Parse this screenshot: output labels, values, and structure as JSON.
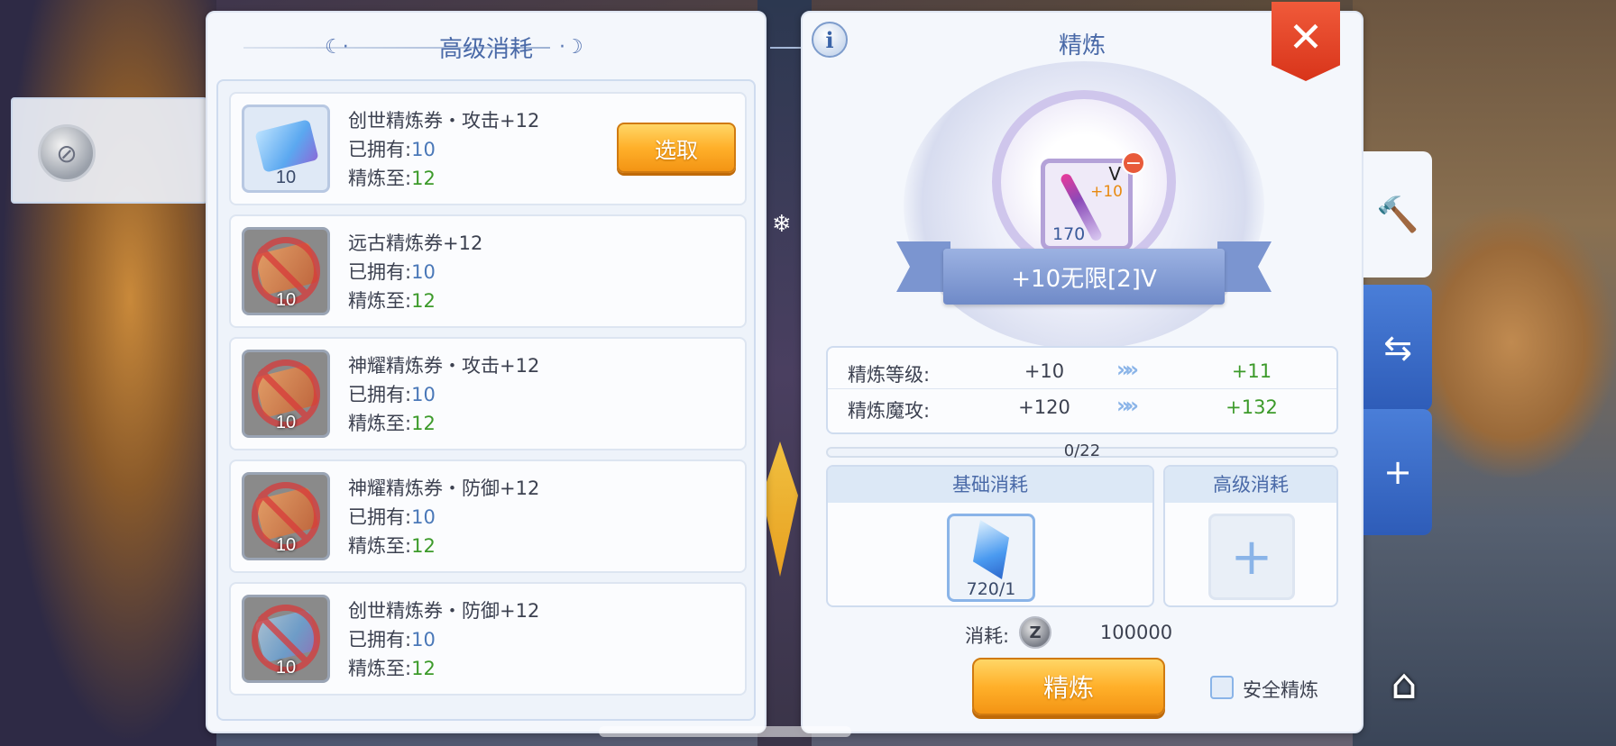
{
  "advanced_panel": {
    "title": "高级消耗",
    "items": [
      {
        "name": "创世精炼券・攻击+12",
        "count": "10",
        "owned_label": "已拥有:",
        "owned": "10",
        "refine_label": "精炼至:",
        "refine_to": "12",
        "locked": false,
        "action": "选取"
      },
      {
        "name": "远古精炼券+12",
        "count": "10",
        "owned_label": "已拥有:",
        "owned": "10",
        "refine_label": "精炼至:",
        "refine_to": "12",
        "locked": true
      },
      {
        "name": "神耀精炼券・攻击+12",
        "count": "10",
        "owned_label": "已拥有:",
        "owned": "10",
        "refine_label": "精炼至:",
        "refine_to": "12",
        "locked": true
      },
      {
        "name": "神耀精炼券・防御+12",
        "count": "10",
        "owned_label": "已拥有:",
        "owned": "10",
        "refine_label": "精炼至:",
        "refine_to": "12",
        "locked": true
      },
      {
        "name": "创世精炼券・防御+12",
        "count": "10",
        "owned_label": "已拥有:",
        "owned": "10",
        "refine_label": "精炼至:",
        "refine_to": "12",
        "locked": true
      }
    ]
  },
  "refine_panel": {
    "title": "精炼",
    "info_icon": "i",
    "close_icon": "✕",
    "equipment": {
      "grade": "V",
      "plus": "+10",
      "level": "170",
      "name": "+10无限[2]V",
      "remove_icon": "−"
    },
    "stats": [
      {
        "label": "精炼等级:",
        "current": "+10",
        "next": "+11"
      },
      {
        "label": "精炼魔攻:",
        "current": "+120",
        "next": "+132"
      }
    ],
    "stat_arrow": "»»",
    "progress": {
      "text": "0/22",
      "fraction": 0
    },
    "base_cost": {
      "title": "基础消耗",
      "count": "720/1"
    },
    "advanced_cost": {
      "title": "高级消耗",
      "add_icon": "+"
    },
    "fee": {
      "label": "消耗:",
      "coin_icon": "Z",
      "value": "100000"
    },
    "refine_button": "精炼",
    "safe_refine": {
      "label": "安全精炼",
      "checked": false
    }
  },
  "side_tabs": [
    {
      "icon": "hammer-icon",
      "glyph": "🔨",
      "active": true
    },
    {
      "icon": "hammer-transfer-icon",
      "glyph": "⇆",
      "active": false
    },
    {
      "icon": "hammer-plus-icon",
      "glyph": "+",
      "active": false
    }
  ],
  "shop_glyph": "⌂",
  "colors": {
    "accent": "#4a6aa8",
    "button_orange": "#ffb02a",
    "close_red": "#e0452a",
    "tab_blue": "#3a6cc8",
    "green": "#3c9a2a"
  }
}
